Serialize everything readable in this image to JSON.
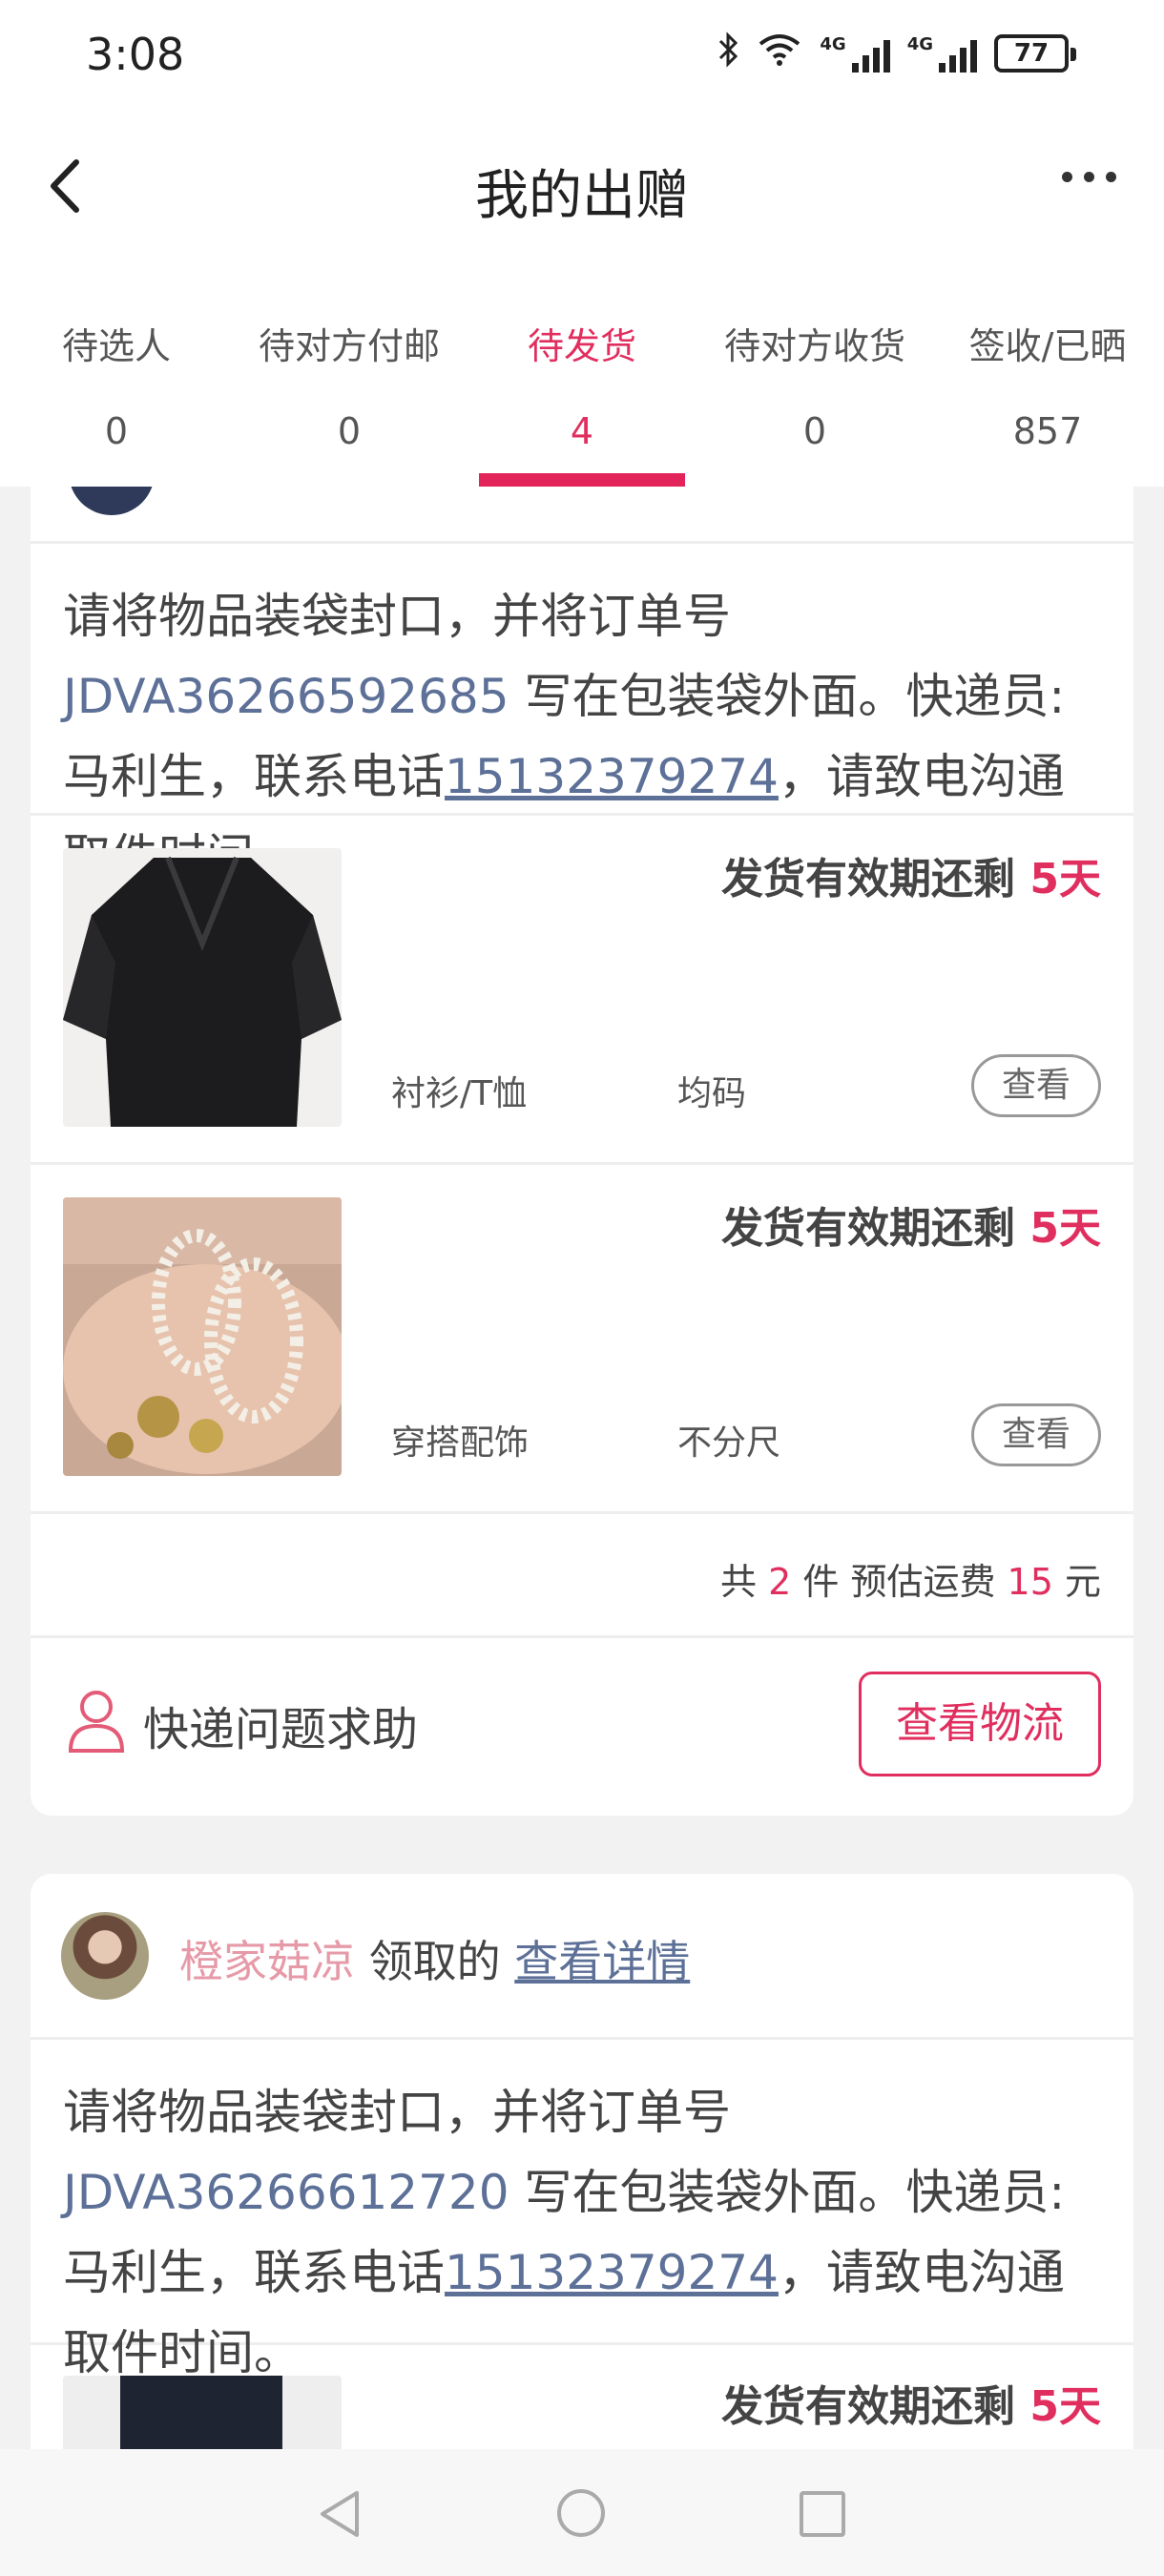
{
  "status_bar": {
    "time": "3:08",
    "net1": "4G",
    "net2": "4G",
    "battery": "77"
  },
  "header": {
    "title": "我的出赠"
  },
  "tabs": [
    {
      "label": "待选人",
      "count": "0"
    },
    {
      "label": "待对方付邮",
      "count": "0"
    },
    {
      "label": "待发货",
      "count": "4"
    },
    {
      "label": "待对方收货",
      "count": "0"
    },
    {
      "label": "签收/已晒",
      "count": "857"
    }
  ],
  "colors": {
    "accent": "#e02e5e",
    "link": "#5d7097"
  },
  "card1": {
    "instruction": {
      "pre": "请将物品装袋封口，并将订单号 ",
      "order_no": "JDVA36266592685",
      "mid": " 写在包装袋外面。快递员:马利生，联系电话",
      "phone": "15132379274",
      "post": "，请致电沟通取件时间。"
    },
    "items": [
      {
        "deadline_label": "发货有效期还剩 ",
        "days": "5天",
        "category": "衬衫/T恤",
        "size": "均码",
        "view": "查看"
      },
      {
        "deadline_label": "发货有效期还剩 ",
        "days": "5天",
        "category": "穿搭配饰",
        "size": "不分尺",
        "view": "查看"
      }
    ],
    "summary": {
      "pre": "共 ",
      "count": "2",
      "mid": " 件 预估运费 ",
      "fee": "15",
      "post": " 元"
    },
    "help_label": "快递问题求助",
    "logistics_button": "查看物流"
  },
  "card2": {
    "user_name": "橙家菇凉",
    "claimed_text": " 领取的 ",
    "detail_link": "查看详情",
    "instruction": {
      "pre": "请将物品装袋封口，并将订单号 ",
      "order_no": "JDVA36266612720",
      "mid": " 写在包装袋外面。快递员:马利生，联系电话",
      "phone": "15132379274",
      "post": "，请致电沟通取件时间。"
    },
    "items": [
      {
        "deadline_label": "发货有效期还剩 ",
        "days": "5天"
      }
    ]
  }
}
